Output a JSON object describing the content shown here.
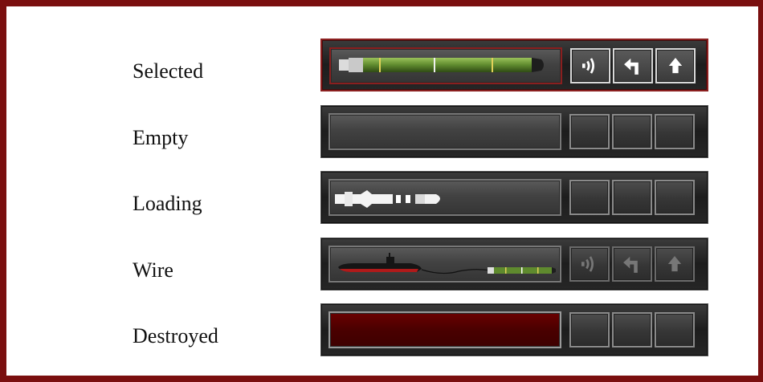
{
  "states": [
    {
      "label": "Selected",
      "tube_content": "torpedo",
      "buttons": [
        "sonar-icon",
        "turn-icon",
        "launch-icon"
      ],
      "buttons_state": "active"
    },
    {
      "label": "Empty",
      "tube_content": "none",
      "buttons": [],
      "buttons_state": "empty"
    },
    {
      "label": "Loading",
      "tube_content": "missile",
      "buttons": [],
      "buttons_state": "empty"
    },
    {
      "label": "Wire",
      "tube_content": "submarine-wire-torpedo",
      "buttons": [
        "sonar-icon",
        "turn-icon",
        "launch-icon"
      ],
      "buttons_state": "disabled"
    },
    {
      "label": "Destroyed",
      "tube_content": "destroyed",
      "buttons": [],
      "buttons_state": "empty"
    }
  ],
  "colors": {
    "frame": "#7a0f0f",
    "selected_border": "#8a1f1f",
    "destroyed_fill": "#4a0000",
    "torpedo_body": "#5f8a2e"
  }
}
